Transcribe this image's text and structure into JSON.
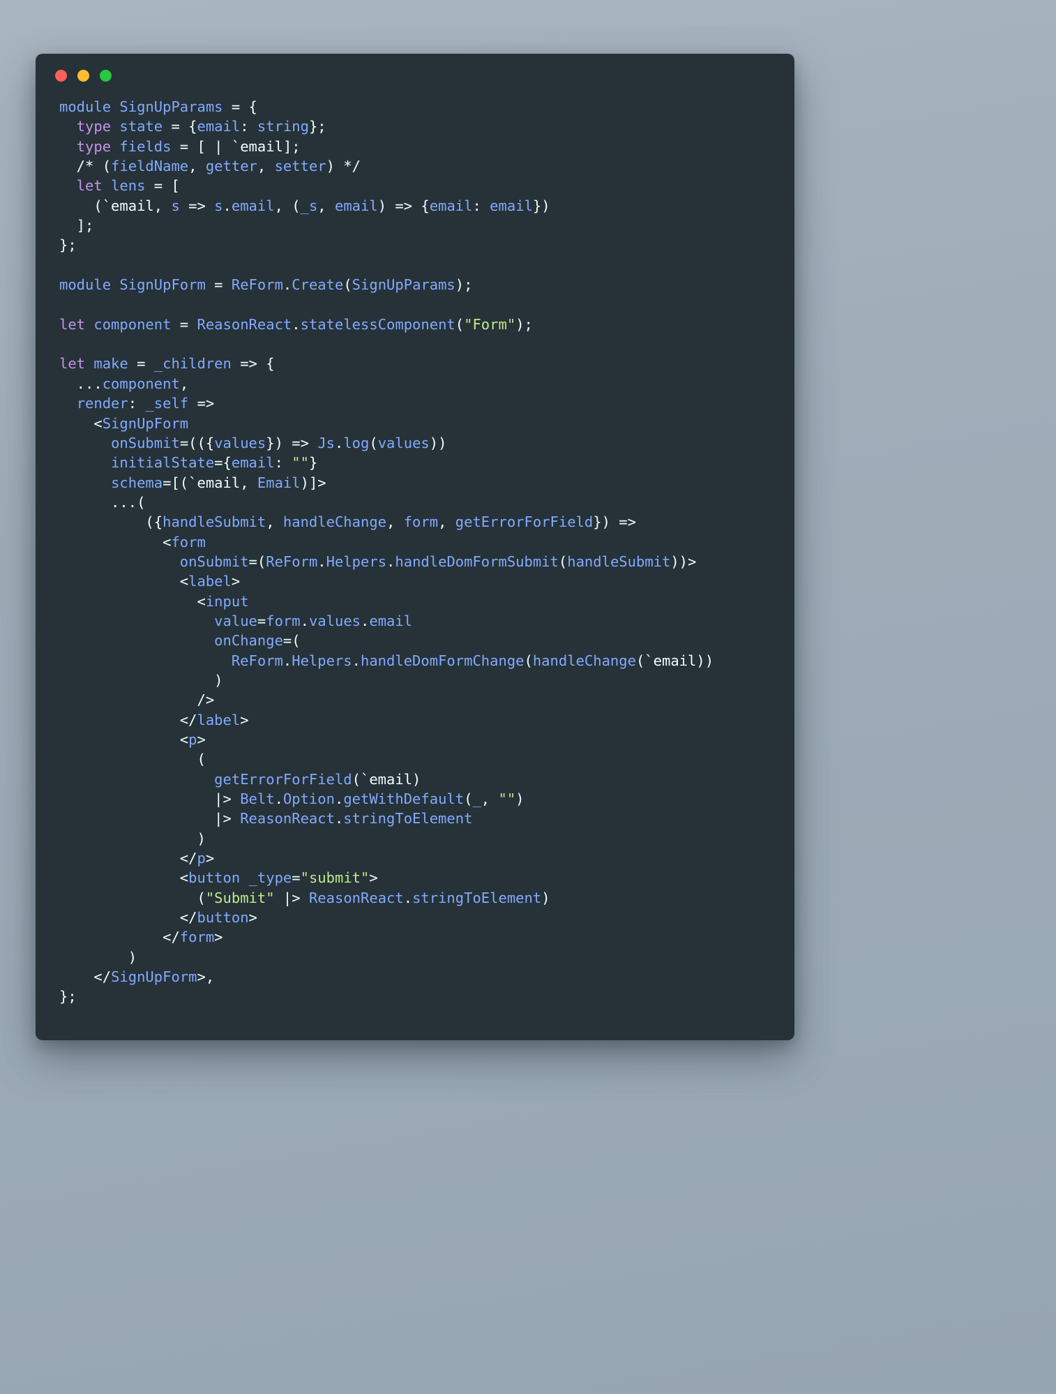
{
  "window": {
    "background_color": "#263238",
    "page_background_color": "#9fadb9",
    "traffic_lights": [
      {
        "name": "close",
        "color": "#ff5f56"
      },
      {
        "name": "minimize",
        "color": "#ffbd2e"
      },
      {
        "name": "maximize",
        "color": "#27c93f"
      }
    ]
  },
  "theme": {
    "keyword_color": "#c792ea",
    "identifier_color": "#82aaff",
    "punctuation_color": "#eeffff",
    "string_color": "#c3e88d",
    "language": "ReasonML"
  },
  "code": {
    "lines": [
      [
        {
          "t": "module ",
          "c": "id"
        },
        {
          "t": "SignUpParams",
          "c": "id"
        },
        {
          "t": " = {",
          "c": "pn"
        }
      ],
      [
        {
          "t": "  ",
          "c": "pn"
        },
        {
          "t": "type",
          "c": "kw"
        },
        {
          "t": " ",
          "c": "pn"
        },
        {
          "t": "state",
          "c": "id"
        },
        {
          "t": " = {",
          "c": "pn"
        },
        {
          "t": "email",
          "c": "id"
        },
        {
          "t": ": ",
          "c": "pn"
        },
        {
          "t": "string",
          "c": "id"
        },
        {
          "t": "};",
          "c": "pn"
        }
      ],
      [
        {
          "t": "  ",
          "c": "pn"
        },
        {
          "t": "type",
          "c": "kw"
        },
        {
          "t": " ",
          "c": "pn"
        },
        {
          "t": "fields",
          "c": "id"
        },
        {
          "t": " = [ | ",
          "c": "pn"
        },
        {
          "t": "`email",
          "c": "pn"
        },
        {
          "t": "];",
          "c": "pn"
        }
      ],
      [
        {
          "t": "  /* (",
          "c": "pn"
        },
        {
          "t": "fieldName",
          "c": "id"
        },
        {
          "t": ", ",
          "c": "pn"
        },
        {
          "t": "getter",
          "c": "id"
        },
        {
          "t": ", ",
          "c": "pn"
        },
        {
          "t": "setter",
          "c": "id"
        },
        {
          "t": ") */",
          "c": "pn"
        }
      ],
      [
        {
          "t": "  ",
          "c": "pn"
        },
        {
          "t": "let",
          "c": "kw"
        },
        {
          "t": " ",
          "c": "pn"
        },
        {
          "t": "lens",
          "c": "id"
        },
        {
          "t": " = [",
          "c": "pn"
        }
      ],
      [
        {
          "t": "    (`email, ",
          "c": "pn"
        },
        {
          "t": "s",
          "c": "id"
        },
        {
          "t": " => ",
          "c": "pn"
        },
        {
          "t": "s",
          "c": "id"
        },
        {
          "t": ".",
          "c": "pn"
        },
        {
          "t": "email",
          "c": "id"
        },
        {
          "t": ", (",
          "c": "pn"
        },
        {
          "t": "_s",
          "c": "id"
        },
        {
          "t": ", ",
          "c": "pn"
        },
        {
          "t": "email",
          "c": "id"
        },
        {
          "t": ") => {",
          "c": "pn"
        },
        {
          "t": "email",
          "c": "id"
        },
        {
          "t": ": ",
          "c": "pn"
        },
        {
          "t": "email",
          "c": "id"
        },
        {
          "t": "})",
          "c": "pn"
        }
      ],
      [
        {
          "t": "  ];",
          "c": "pn"
        }
      ],
      [
        {
          "t": "};",
          "c": "pn"
        }
      ],
      [],
      [
        {
          "t": "module ",
          "c": "id"
        },
        {
          "t": "SignUpForm",
          "c": "id"
        },
        {
          "t": " = ",
          "c": "pn"
        },
        {
          "t": "ReForm",
          "c": "id"
        },
        {
          "t": ".",
          "c": "pn"
        },
        {
          "t": "Create",
          "c": "id"
        },
        {
          "t": "(",
          "c": "pn"
        },
        {
          "t": "SignUpParams",
          "c": "id"
        },
        {
          "t": ");",
          "c": "pn"
        }
      ],
      [],
      [
        {
          "t": "let",
          "c": "kw"
        },
        {
          "t": " ",
          "c": "pn"
        },
        {
          "t": "component",
          "c": "id"
        },
        {
          "t": " = ",
          "c": "pn"
        },
        {
          "t": "ReasonReact",
          "c": "id"
        },
        {
          "t": ".",
          "c": "pn"
        },
        {
          "t": "statelessComponent",
          "c": "id"
        },
        {
          "t": "(",
          "c": "pn"
        },
        {
          "t": "\"Form\"",
          "c": "st"
        },
        {
          "t": ");",
          "c": "pn"
        }
      ],
      [],
      [
        {
          "t": "let",
          "c": "kw"
        },
        {
          "t": " ",
          "c": "pn"
        },
        {
          "t": "make",
          "c": "id"
        },
        {
          "t": " = ",
          "c": "pn"
        },
        {
          "t": "_children",
          "c": "id"
        },
        {
          "t": " => {",
          "c": "pn"
        }
      ],
      [
        {
          "t": "  ...",
          "c": "pn"
        },
        {
          "t": "component",
          "c": "id"
        },
        {
          "t": ",",
          "c": "pn"
        }
      ],
      [
        {
          "t": "  ",
          "c": "pn"
        },
        {
          "t": "render",
          "c": "id"
        },
        {
          "t": ": ",
          "c": "pn"
        },
        {
          "t": "_self",
          "c": "id"
        },
        {
          "t": " =>",
          "c": "pn"
        }
      ],
      [
        {
          "t": "    <",
          "c": "pn"
        },
        {
          "t": "SignUpForm",
          "c": "id"
        }
      ],
      [
        {
          "t": "      ",
          "c": "pn"
        },
        {
          "t": "onSubmit",
          "c": "id"
        },
        {
          "t": "=(({",
          "c": "pn"
        },
        {
          "t": "values",
          "c": "id"
        },
        {
          "t": "}) => ",
          "c": "pn"
        },
        {
          "t": "Js",
          "c": "id"
        },
        {
          "t": ".",
          "c": "pn"
        },
        {
          "t": "log",
          "c": "id"
        },
        {
          "t": "(",
          "c": "pn"
        },
        {
          "t": "values",
          "c": "id"
        },
        {
          "t": "))",
          "c": "pn"
        }
      ],
      [
        {
          "t": "      ",
          "c": "pn"
        },
        {
          "t": "initialState",
          "c": "id"
        },
        {
          "t": "={",
          "c": "pn"
        },
        {
          "t": "email",
          "c": "id"
        },
        {
          "t": ": ",
          "c": "pn"
        },
        {
          "t": "\"\"",
          "c": "st"
        },
        {
          "t": "}",
          "c": "pn"
        }
      ],
      [
        {
          "t": "      ",
          "c": "pn"
        },
        {
          "t": "schema",
          "c": "id"
        },
        {
          "t": "=[(`email, ",
          "c": "pn"
        },
        {
          "t": "Email",
          "c": "id"
        },
        {
          "t": ")]>",
          "c": "pn"
        }
      ],
      [
        {
          "t": "      ...(",
          "c": "pn"
        }
      ],
      [
        {
          "t": "          ({",
          "c": "pn"
        },
        {
          "t": "handleSubmit",
          "c": "id"
        },
        {
          "t": ", ",
          "c": "pn"
        },
        {
          "t": "handleChange",
          "c": "id"
        },
        {
          "t": ", ",
          "c": "pn"
        },
        {
          "t": "form",
          "c": "id"
        },
        {
          "t": ", ",
          "c": "pn"
        },
        {
          "t": "getErrorForField",
          "c": "id"
        },
        {
          "t": "}) =>",
          "c": "pn"
        }
      ],
      [
        {
          "t": "            <",
          "c": "pn"
        },
        {
          "t": "form",
          "c": "id"
        }
      ],
      [
        {
          "t": "              ",
          "c": "pn"
        },
        {
          "t": "onSubmit",
          "c": "id"
        },
        {
          "t": "=(",
          "c": "pn"
        },
        {
          "t": "ReForm",
          "c": "id"
        },
        {
          "t": ".",
          "c": "pn"
        },
        {
          "t": "Helpers",
          "c": "id"
        },
        {
          "t": ".",
          "c": "pn"
        },
        {
          "t": "handleDomFormSubmit",
          "c": "id"
        },
        {
          "t": "(",
          "c": "pn"
        },
        {
          "t": "handleSubmit",
          "c": "id"
        },
        {
          "t": "))>",
          "c": "pn"
        }
      ],
      [
        {
          "t": "              <",
          "c": "pn"
        },
        {
          "t": "label",
          "c": "id"
        },
        {
          "t": ">",
          "c": "pn"
        }
      ],
      [
        {
          "t": "                <",
          "c": "pn"
        },
        {
          "t": "input",
          "c": "id"
        }
      ],
      [
        {
          "t": "                  ",
          "c": "pn"
        },
        {
          "t": "value",
          "c": "id"
        },
        {
          "t": "=",
          "c": "pn"
        },
        {
          "t": "form",
          "c": "id"
        },
        {
          "t": ".",
          "c": "pn"
        },
        {
          "t": "values",
          "c": "id"
        },
        {
          "t": ".",
          "c": "pn"
        },
        {
          "t": "email",
          "c": "id"
        }
      ],
      [
        {
          "t": "                  ",
          "c": "pn"
        },
        {
          "t": "onChange",
          "c": "id"
        },
        {
          "t": "=(",
          "c": "pn"
        }
      ],
      [
        {
          "t": "                    ",
          "c": "pn"
        },
        {
          "t": "ReForm",
          "c": "id"
        },
        {
          "t": ".",
          "c": "pn"
        },
        {
          "t": "Helpers",
          "c": "id"
        },
        {
          "t": ".",
          "c": "pn"
        },
        {
          "t": "handleDomFormChange",
          "c": "id"
        },
        {
          "t": "(",
          "c": "pn"
        },
        {
          "t": "handleChange",
          "c": "id"
        },
        {
          "t": "(`email))",
          "c": "pn"
        }
      ],
      [
        {
          "t": "                  )",
          "c": "pn"
        }
      ],
      [
        {
          "t": "                />",
          "c": "pn"
        }
      ],
      [
        {
          "t": "              </",
          "c": "pn"
        },
        {
          "t": "label",
          "c": "id"
        },
        {
          "t": ">",
          "c": "pn"
        }
      ],
      [
        {
          "t": "              <",
          "c": "pn"
        },
        {
          "t": "p",
          "c": "id"
        },
        {
          "t": ">",
          "c": "pn"
        }
      ],
      [
        {
          "t": "                (",
          "c": "pn"
        }
      ],
      [
        {
          "t": "                  ",
          "c": "pn"
        },
        {
          "t": "getErrorForField",
          "c": "id"
        },
        {
          "t": "(`email)",
          "c": "pn"
        }
      ],
      [
        {
          "t": "                  |> ",
          "c": "pn"
        },
        {
          "t": "Belt",
          "c": "id"
        },
        {
          "t": ".",
          "c": "pn"
        },
        {
          "t": "Option",
          "c": "id"
        },
        {
          "t": ".",
          "c": "pn"
        },
        {
          "t": "getWithDefault",
          "c": "id"
        },
        {
          "t": "(",
          "c": "pn"
        },
        {
          "t": "_",
          "c": "id"
        },
        {
          "t": ", ",
          "c": "pn"
        },
        {
          "t": "\"\"",
          "c": "st"
        },
        {
          "t": ")",
          "c": "pn"
        }
      ],
      [
        {
          "t": "                  |> ",
          "c": "pn"
        },
        {
          "t": "ReasonReact",
          "c": "id"
        },
        {
          "t": ".",
          "c": "pn"
        },
        {
          "t": "stringToElement",
          "c": "id"
        }
      ],
      [
        {
          "t": "                )",
          "c": "pn"
        }
      ],
      [
        {
          "t": "              </",
          "c": "pn"
        },
        {
          "t": "p",
          "c": "id"
        },
        {
          "t": ">",
          "c": "pn"
        }
      ],
      [
        {
          "t": "              <",
          "c": "pn"
        },
        {
          "t": "button",
          "c": "id"
        },
        {
          "t": " ",
          "c": "pn"
        },
        {
          "t": "_type",
          "c": "id"
        },
        {
          "t": "=",
          "c": "pn"
        },
        {
          "t": "\"submit\"",
          "c": "st"
        },
        {
          "t": ">",
          "c": "pn"
        }
      ],
      [
        {
          "t": "                (",
          "c": "pn"
        },
        {
          "t": "\"Submit\"",
          "c": "st"
        },
        {
          "t": " |> ",
          "c": "pn"
        },
        {
          "t": "ReasonReact",
          "c": "id"
        },
        {
          "t": ".",
          "c": "pn"
        },
        {
          "t": "stringToElement",
          "c": "id"
        },
        {
          "t": ")",
          "c": "pn"
        }
      ],
      [
        {
          "t": "              </",
          "c": "pn"
        },
        {
          "t": "button",
          "c": "id"
        },
        {
          "t": ">",
          "c": "pn"
        }
      ],
      [
        {
          "t": "            </",
          "c": "pn"
        },
        {
          "t": "form",
          "c": "id"
        },
        {
          "t": ">",
          "c": "pn"
        }
      ],
      [
        {
          "t": "        )",
          "c": "pn"
        }
      ],
      [
        {
          "t": "    </",
          "c": "pn"
        },
        {
          "t": "SignUpForm",
          "c": "id"
        },
        {
          "t": ">,",
          "c": "pn"
        }
      ],
      [
        {
          "t": "};",
          "c": "pn"
        }
      ]
    ],
    "plain_text": "module SignUpParams = {\n  type state = {email: string};\n  type fields = [ | `email];\n  /* (fieldName, getter, setter) */\n  let lens = [\n    (`email, s => s.email, (_s, email) => {email: email})\n  ];\n};\n\nmodule SignUpForm = ReForm.Create(SignUpParams);\n\nlet component = ReasonReact.statelessComponent(\"Form\");\n\nlet make = _children => {\n  ...component,\n  render: _self =>\n    <SignUpForm\n      onSubmit=(({values}) => Js.log(values))\n      initialState={email: \"\"}\n      schema=[(`email, Email)]>\n      ...(\n          ({handleSubmit, handleChange, form, getErrorForField}) =>\n            <form\n              onSubmit=(ReForm.Helpers.handleDomFormSubmit(handleSubmit))>\n              <label>\n                <input\n                  value=form.values.email\n                  onChange=(\n                    ReForm.Helpers.handleDomFormChange(handleChange(`email))\n                  )\n                />\n              </label>\n              <p>\n                (\n                  getErrorForField(`email)\n                  |> Belt.Option.getWithDefault(_, \"\")\n                  |> ReasonReact.stringToElement\n                )\n              </p>\n              <button _type=\"submit\">\n                (\"Submit\" |> ReasonReact.stringToElement)\n              </button>\n            </form>\n        )\n    </SignUpForm>,\n};"
  }
}
